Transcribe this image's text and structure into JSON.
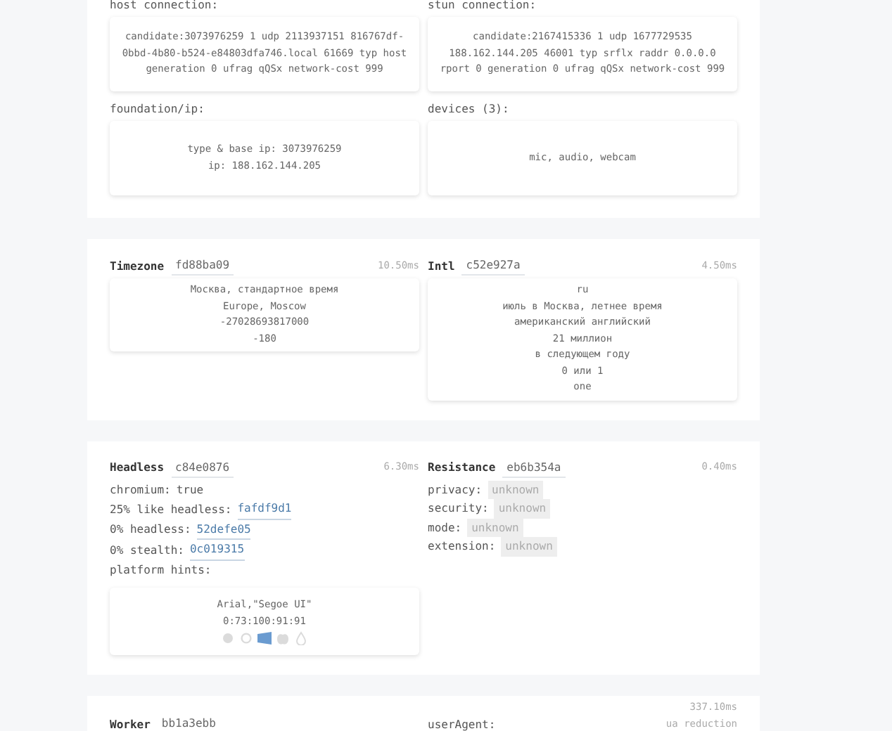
{
  "sections": [
    {
      "kind": "grid",
      "cells": [
        {
          "label": "host connection:",
          "lines": [
            "candidate:3073976259 1 udp 2113937151 816767df-0bbd-4b80-b524-e84803dfa746.local 61669 typ host generation 0 ufrag qQSx network-cost 999"
          ]
        },
        {
          "label": "stun connection:",
          "lines": [
            "candidate:2167415336 1 udp 1677729535 188.162.144.205 46001 typ srflx raddr 0.0.0.0 rport 0 generation 0 ufrag qQSx network-cost 999"
          ]
        },
        {
          "label": "foundation/ip:",
          "lines": [
            "type & base ip: 3073976259",
            "ip: 188.162.144.205"
          ]
        },
        {
          "label": "devices (3):",
          "lines": [
            "mic, audio, webcam"
          ]
        }
      ]
    },
    {
      "kind": "panels",
      "panels": [
        {
          "title": "Timezone",
          "hash": "fd88ba09",
          "time": "10.50ms",
          "lines": [
            "Москва, стандартное время",
            "Europe, Moscow",
            "-27028693817000",
            "-180"
          ]
        },
        {
          "title": "Intl",
          "hash": "c52e927a",
          "time": "4.50ms",
          "lines": [
            "ru",
            "июль в Москва, летнее время",
            "американский английский",
            "21 миллион",
            "в следующем году",
            "0 или 1",
            "one"
          ]
        }
      ]
    },
    {
      "kind": "panels",
      "panels": [
        {
          "title": "Headless",
          "hash": "c84e0876",
          "time": "6.30ms",
          "rows": [
            {
              "label": "chromium:",
              "kind": "text",
              "value": "true"
            },
            {
              "label": "25% like headless:",
              "kind": "link",
              "value": "fafdf9d1"
            },
            {
              "label": "0% headless:",
              "kind": "link",
              "value": "52defe05"
            },
            {
              "label": "0% stealth:",
              "kind": "link",
              "value": "0c019315"
            },
            {
              "label": "platform hints:",
              "kind": "none"
            }
          ],
          "lines": [
            "Arial,\"Segoe UI\"",
            "0:73:100:91:91"
          ],
          "platforms": [
            {
              "kind": "robot",
              "selected": false
            },
            {
              "kind": "circle",
              "selected": false
            },
            {
              "kind": "windows",
              "selected": true
            },
            {
              "kind": "apple",
              "selected": false
            },
            {
              "kind": "drop",
              "selected": false
            }
          ]
        },
        {
          "title": "Resistance",
          "hash": "eb6b354a",
          "time": "0.40ms",
          "rows": [
            {
              "label": "privacy:",
              "kind": "tag",
              "value": "unknown"
            },
            {
              "label": "security:",
              "kind": "tag",
              "value": "unknown"
            },
            {
              "label": "mode:",
              "kind": "tag",
              "value": "unknown"
            },
            {
              "label": "extension:",
              "kind": "tag",
              "value": "unknown"
            }
          ]
        }
      ]
    },
    {
      "kind": "panels",
      "panels": [
        {
          "title": "Worker",
          "hash": "bb1a3ebb"
        },
        {
          "label": "userAgent:",
          "time": "337.10ms",
          "note": "ua reduction"
        }
      ]
    }
  ]
}
